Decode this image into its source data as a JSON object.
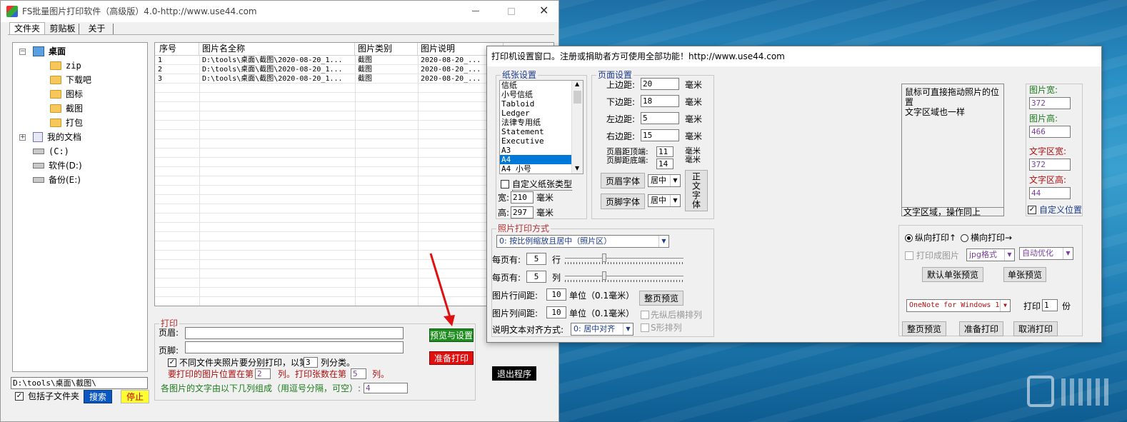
{
  "main_window": {
    "title": "FS批量图片打印软件（高级版）4.0-http://www.use44.com",
    "tabs": [
      "文件夹",
      "剪贴板",
      "关于"
    ],
    "tree": {
      "desktop": "桌面",
      "children": [
        "zip",
        "下载吧",
        "图标",
        "截图",
        "打包"
      ],
      "my_docs": "我的文档",
      "drives": [
        "(C:)",
        "软件(D:)",
        "备份(E:)"
      ]
    },
    "table": {
      "columns": [
        "序号",
        "图片名全称",
        "图片类别",
        "图片说明"
      ],
      "rows": [
        [
          "1",
          "D:\\tools\\桌面\\截图\\2020-08-20_1...",
          "截图",
          "2020-08-20_..."
        ],
        [
          "2",
          "D:\\tools\\桌面\\截图\\2020-08-20_1...",
          "截图",
          "2020-08-20_..."
        ],
        [
          "3",
          "D:\\tools\\桌面\\截图\\2020-08-20_1...",
          "截图",
          "2020-08-20_..."
        ]
      ]
    },
    "path_value": "D:\\tools\\桌面\\截图\\",
    "include_subfolders": "包括子文件夹",
    "search_button": "搜索",
    "stop_button": "停止",
    "print_group": {
      "title": "打印",
      "header_label": "页眉:",
      "footer_label": "页脚:",
      "separate_label": "不同文件夹照片要分别打印，以第",
      "separate_value": "3",
      "separate_suffix": "列分类。",
      "position_label": "要打印的图片位置在第",
      "position_value": "2",
      "position_mid": "列。打印张数在第",
      "count_value": "5",
      "count_suffix": "列。",
      "text_compose_label": "各图片的文字由以下几列组成（用逗号分隔，可空）:",
      "text_compose_value": "4",
      "preview_button": "预览与设置",
      "ready_button": "准备打印"
    },
    "exit_button": "退出程序"
  },
  "dialog": {
    "title": "打印机设置窗口。注册或捐助者方可使用全部功能！http://www.use44.com",
    "paper": {
      "title": "纸张设置",
      "sizes": [
        "信纸",
        "小号信纸",
        "Tabloid",
        "Ledger",
        "法律专用纸",
        "Statement",
        "Executive",
        "A3",
        "A4",
        "A4 小号"
      ],
      "selected": "A4",
      "custom_label": "自定义纸张类型",
      "width_label": "宽:",
      "width_value": "210",
      "height_label": "高:",
      "height_value": "297",
      "unit": "毫米"
    },
    "page": {
      "title": "页面设置",
      "top_label": "上边距:",
      "top_value": "20",
      "bottom_label": "下边距:",
      "bottom_value": "18",
      "left_label": "左边距:",
      "left_value": "5",
      "right_label": "右边距:",
      "right_value": "15",
      "header_dist_label": "页眉距顶端:",
      "header_dist_value": "11",
      "footer_dist_label": "页脚距底端:",
      "footer_dist_value": "14",
      "unit": "毫米",
      "header_font_button": "页眉字体",
      "footer_font_button": "页脚字体",
      "align_value": "居中",
      "body_font_button": "正文字体"
    },
    "photo": {
      "title": "照片打印方式",
      "mode_value": "0: 按比例缩放且居中（照片区）",
      "per_page_label": "每页有:",
      "rows_value": "5",
      "rows_unit": "行",
      "cols_value": "5",
      "cols_unit": "列",
      "row_gap_label": "图片行间距:",
      "row_gap_value": "10",
      "col_gap_label": "图片列间距:",
      "col_gap_value": "10",
      "gap_unit": "单位（0.1毫米）",
      "full_preview_button": "整页预览",
      "vert_then_horiz": "先纵后横排列",
      "s_shape": "S形排列",
      "text_align_label": "说明文本对齐方式:",
      "text_align_value": "0: 居中对齐"
    },
    "preview_area": {
      "hint": "鼠标可直接拖动照片的位置\n文字区域也一样",
      "caption": "文字区域，操作同上"
    },
    "sizes": {
      "img_width_label": "图片宽:",
      "img_width_value": "372",
      "img_height_label": "图片高:",
      "img_height_value": "466",
      "text_width_label": "文字区宽:",
      "text_width_value": "372",
      "text_height_label": "文字区高:",
      "text_height_value": "44",
      "custom_pos_label": "自定义位置"
    },
    "output": {
      "portrait_label": "纵向打印↑",
      "landscape_label": "横向打印→",
      "print_as_image_label": "打印成图片",
      "format_value": "jpg格式",
      "optimize_value": "自动优化",
      "default_single_preview_button": "默认单张预览",
      "single_preview_button": "单张预览",
      "printer_value": "OneNote for Windows 1",
      "print_label": "打印",
      "copies_value": "1",
      "copies_unit": "份",
      "full_preview_button": "整页预览",
      "ready_button": "准备打印",
      "cancel_button": "取消打印"
    }
  },
  "colors": {
    "green_button": "#1e8c1e",
    "red_button": "#e01010",
    "yellow_button": "#ffff33",
    "blue_button": "#0a57c2",
    "group_title_red": "#b83232",
    "group_title_green": "#1c7a1c"
  }
}
